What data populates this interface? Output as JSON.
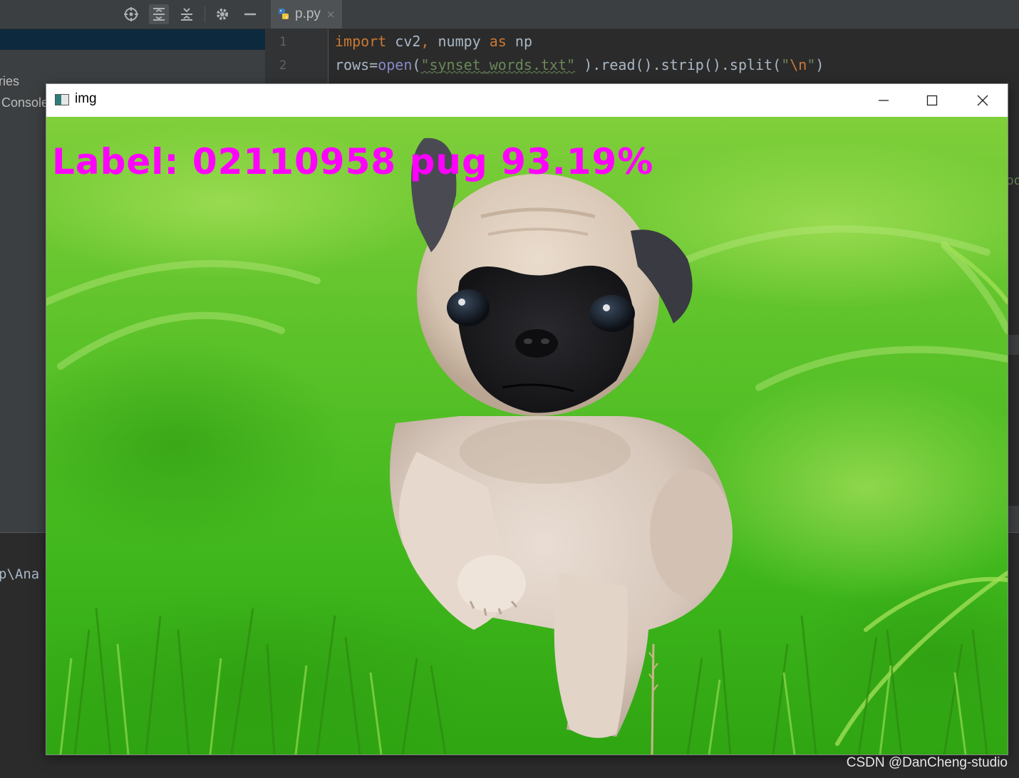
{
  "ide": {
    "left_panel": {
      "toolbar_icons": [
        "locate-icon",
        "expand-all-icon",
        "collapse-all-icon",
        "gear-icon",
        "minimize-icon"
      ],
      "partial_items": [
        "ries",
        "Console"
      ],
      "console_path_fragment": "p\\Ana"
    },
    "editor": {
      "tab": {
        "label": "p.py",
        "icon": "python-file-icon",
        "close_glyph": "×"
      },
      "line_numbers": [
        "1",
        "2"
      ],
      "lines": [
        {
          "tokens": [
            {
              "t": "import",
              "c": "kw"
            },
            {
              "t": " cv2",
              "c": "op"
            },
            {
              "t": ",",
              "c": "kw"
            },
            {
              "t": " numpy ",
              "c": "op"
            },
            {
              "t": "as",
              "c": "kw"
            },
            {
              "t": " np",
              "c": "op"
            }
          ]
        },
        {
          "tokens": [
            {
              "t": "rows",
              "c": "op"
            },
            {
              "t": "=",
              "c": "op"
            },
            {
              "t": "open",
              "c": "bi"
            },
            {
              "t": "(",
              "c": "op"
            },
            {
              "t": "\"synset_words.txt\"",
              "c": "str"
            },
            {
              "t": " ",
              "c": "op"
            },
            {
              "t": ").read().strip().split(",
              "c": "op"
            },
            {
              "t": "\"",
              "c": "str2"
            },
            {
              "t": "\\n",
              "c": "esc"
            },
            {
              "t": "\"",
              "c": "str2"
            },
            {
              "t": ")",
              "c": "op"
            }
          ]
        }
      ],
      "right_fragment": "od"
    }
  },
  "image_window": {
    "title": "img",
    "controls": [
      "minimize-icon",
      "maximize-icon",
      "close-icon"
    ],
    "overlay_label": "Label: 02110958 pug 93.19%",
    "overlay_color": "#ff00ff"
  },
  "watermark": "CSDN @DanCheng-studio"
}
